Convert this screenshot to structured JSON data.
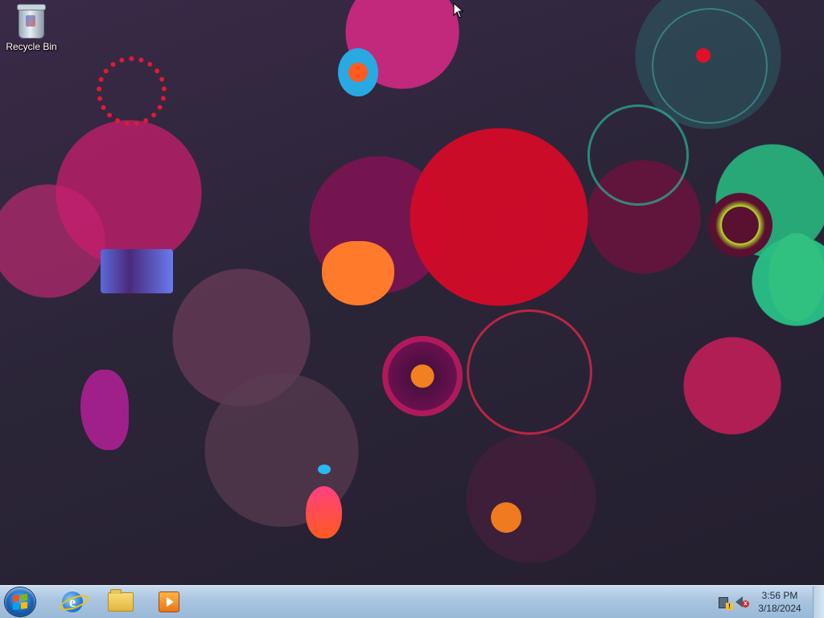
{
  "desktop": {
    "icons": [
      {
        "label": "Recycle Bin",
        "icon": "recycle-bin-icon"
      }
    ]
  },
  "taskbar": {
    "start_icon": "windows-logo-icon",
    "pinned": [
      {
        "icon": "internet-explorer-icon"
      },
      {
        "icon": "file-explorer-icon"
      },
      {
        "icon": "media-player-icon"
      }
    ],
    "tray": {
      "icons": [
        "network-warning-icon",
        "volume-muted-icon"
      ],
      "time": "3:56 PM",
      "date": "3/18/2024"
    }
  },
  "colors": {
    "taskbar": "#a9c4df",
    "desktop_background": "#2a2236"
  }
}
